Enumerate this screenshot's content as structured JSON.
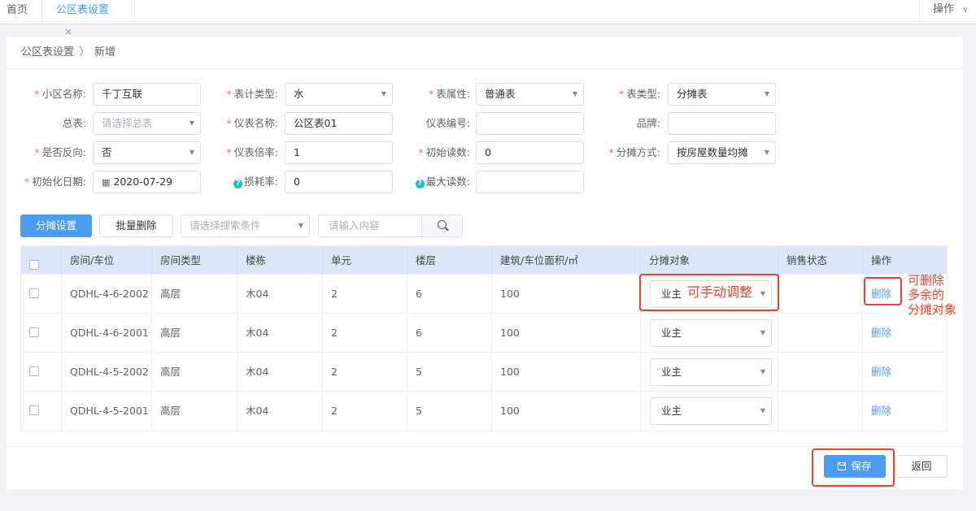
{
  "tabs": [
    {
      "label": "首页"
    },
    {
      "label": "公区表设置",
      "close": "×"
    }
  ],
  "ops_menu": {
    "label": "操作",
    "chevron": "∨"
  },
  "breadcrumb": {
    "parent": "公区表设置",
    "separator": "〉",
    "current": "新增"
  },
  "form": {
    "community_name": {
      "label": "小区名称:",
      "value": "千丁互联",
      "required": true
    },
    "meter_type": {
      "label": "表计类型:",
      "value": "水",
      "required": true
    },
    "meter_attr": {
      "label": "表属性:",
      "value": "普通表",
      "required": true
    },
    "table_type": {
      "label": "表类型:",
      "value": "分摊表",
      "required": true
    },
    "main_meter": {
      "label": "总表:",
      "placeholder": "请选择总表",
      "required": false
    },
    "meter_name": {
      "label": "仪表名称:",
      "value": "公区表01",
      "required": true
    },
    "meter_no": {
      "label": "仪表编号:",
      "value": "",
      "required": false
    },
    "brand": {
      "label": "品牌:",
      "value": "",
      "required": false
    },
    "reverse": {
      "label": "是否反向:",
      "value": "否",
      "required": true
    },
    "multiplier": {
      "label": "仪表倍率:",
      "value": "1",
      "required": true
    },
    "initial_reading": {
      "label": "初始读数:",
      "value": "0",
      "required": true
    },
    "allocation_method": {
      "label": "分摊方式:",
      "value": "按房屋数量均摊",
      "required": true
    },
    "init_date": {
      "label": "初始化日期:",
      "value": "2020-07-29",
      "required": true
    },
    "loss_rate": {
      "label": "损耗率:",
      "value": "0",
      "help": "?"
    },
    "max_reading": {
      "label": "最大读数:",
      "value": "",
      "help": "?"
    }
  },
  "toolbar": {
    "allocate_btn": "分摊设置",
    "batch_delete_btn": "批量删除",
    "search_condition_placeholder": "请选择搜索条件",
    "search_input_placeholder": "请输入内容"
  },
  "table": {
    "headers": [
      "房间/车位",
      "房间类型",
      "楼栋",
      "单元",
      "楼层",
      "建筑/车位面积/㎡",
      "分摊对象",
      "销售状态",
      "操作"
    ],
    "rows": [
      {
        "room": "QDHL-4-6-2002",
        "type": "高层",
        "building": "木04",
        "unit": "2",
        "floor": "6",
        "area": "100",
        "object": "业主",
        "status": "",
        "action": "删除"
      },
      {
        "room": "QDHL-4-6-2001",
        "type": "高层",
        "building": "木04",
        "unit": "2",
        "floor": "6",
        "area": "100",
        "object": "业主",
        "status": "",
        "action": "删除"
      },
      {
        "room": "QDHL-4-5-2002",
        "type": "高层",
        "building": "木04",
        "unit": "2",
        "floor": "5",
        "area": "100",
        "object": "业主",
        "status": "",
        "action": "删除"
      },
      {
        "room": "QDHL-4-5-2001",
        "type": "高层",
        "building": "木04",
        "unit": "2",
        "floor": "5",
        "area": "100",
        "object": "业主",
        "status": "",
        "action": "删除"
      }
    ]
  },
  "footer": {
    "save_btn": "保存",
    "back_btn": "返回"
  },
  "annotations": {
    "adjust_note": "可手动调整",
    "delete_note_line1": "可删除",
    "delete_note_line2": "多余的",
    "delete_note_line3": "分摊对象",
    "color": "#e8412c"
  },
  "colors": {
    "primary": "#4c9cf0",
    "required": "#f56c6c",
    "header_bg": "#dde7f7"
  }
}
